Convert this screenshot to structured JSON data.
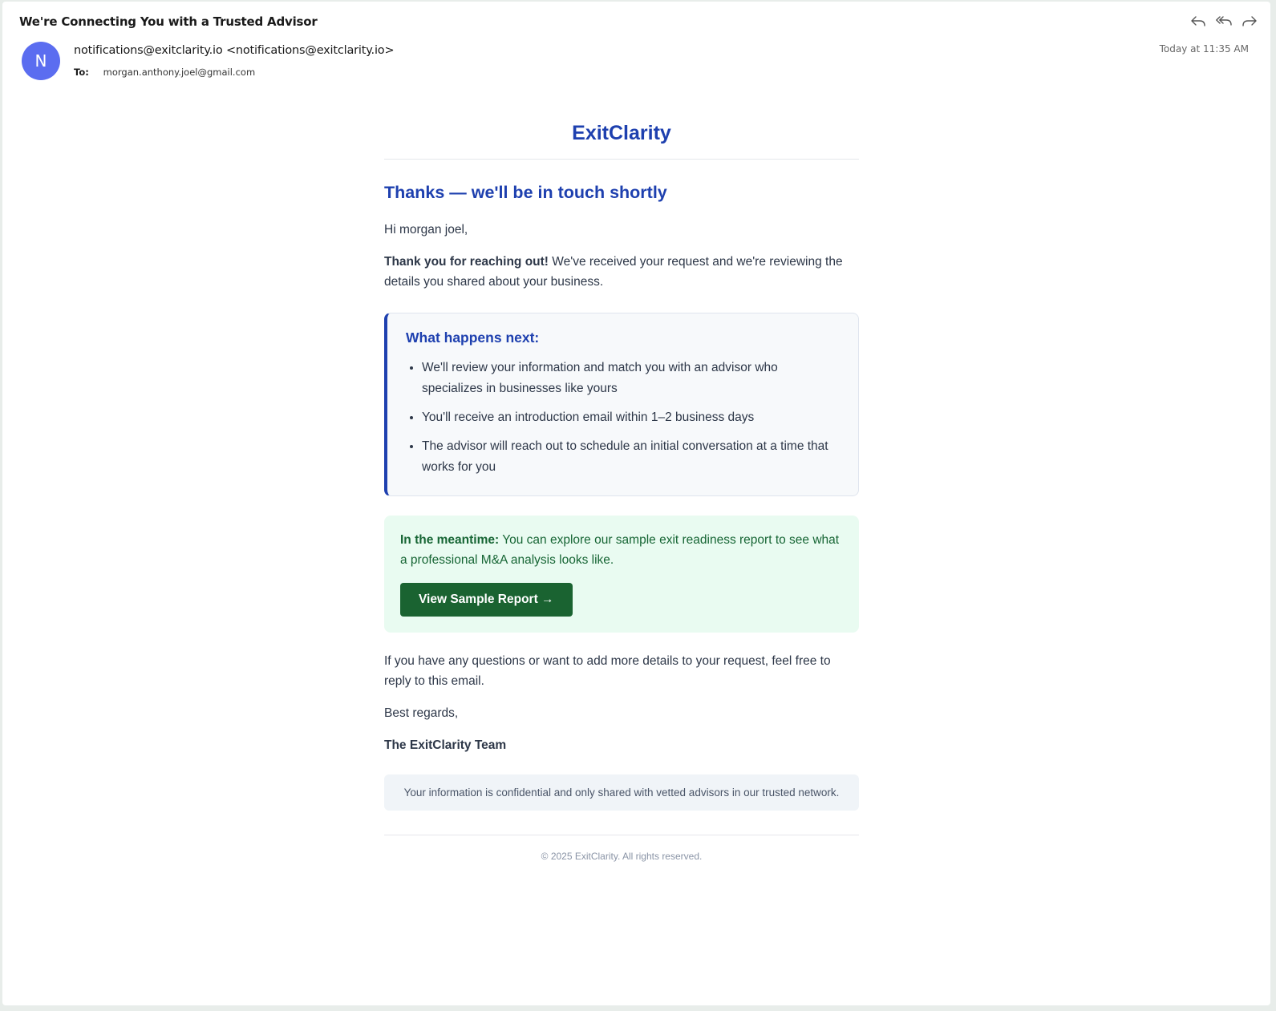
{
  "email": {
    "subject": "We're Connecting You with a Trusted Advisor",
    "avatar_letter": "N",
    "from": "notifications@exitclarity.io <notifications@exitclarity.io>",
    "to_label": "To:",
    "to": "morgan.anthony.joel@gmail.com",
    "date": "Today at 11:35 AM",
    "actions": [
      "reply-icon",
      "reply-all-icon",
      "forward-icon"
    ]
  },
  "body": {
    "brand": "ExitClarity",
    "heading": "Thanks — we'll be in touch shortly",
    "greeting": "Hi morgan joel,",
    "intro_bold": "Thank you for reaching out!",
    "intro_rest": " We've received your request and we're reviewing the details you shared about your business.",
    "next_title": "What happens next:",
    "next_items": [
      "We'll review your information and match you with an advisor who specializes in businesses like yours",
      "You'll receive an introduction email within 1–2 business days",
      "The advisor will reach out to schedule an initial conversation at a time that works for you"
    ],
    "meantime_bold": "In the meantime:",
    "meantime_rest": " You can explore our sample exit readiness report to see what a professional M&A analysis looks like.",
    "cta_label": "View Sample Report →",
    "questions": "If you have any questions or want to add more details to your request, feel free to reply to this email.",
    "regards": "Best regards,",
    "team": "The ExitClarity Team",
    "confidential": "Your information is confidential and only shared with vetted advisors in our trusted network.",
    "footer": "© 2025 ExitClarity. All rights reserved."
  },
  "colors": {
    "brand_blue": "#1e40af",
    "cta_green": "#1a6331",
    "avatar": "#5b6df0"
  }
}
